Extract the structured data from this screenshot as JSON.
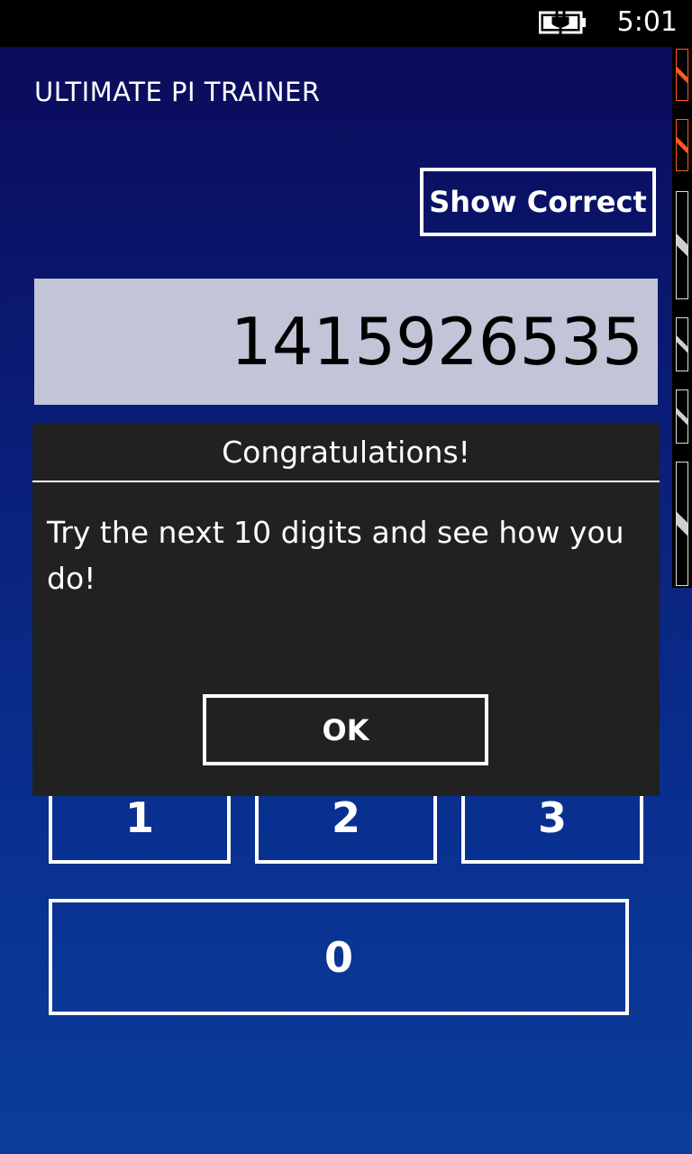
{
  "status_bar": {
    "time": "5:01",
    "battery_icon": "battery-charging-icon"
  },
  "app": {
    "title": "ULTIMATE PI TRAINER",
    "show_correct_label": "Show Correct",
    "digits": "1415926535"
  },
  "keypad": {
    "keys": [
      "1",
      "2",
      "3"
    ],
    "zero": "0"
  },
  "dialog": {
    "title": "Congratulations!",
    "message": "Try the next 10 digits and see how you do!",
    "ok_label": "OK"
  },
  "colors": {
    "background_top": "#0b0b5a",
    "background_bottom": "#0a3d99",
    "display_bg": "#c2c4d8",
    "dialog_bg": "#212121"
  }
}
